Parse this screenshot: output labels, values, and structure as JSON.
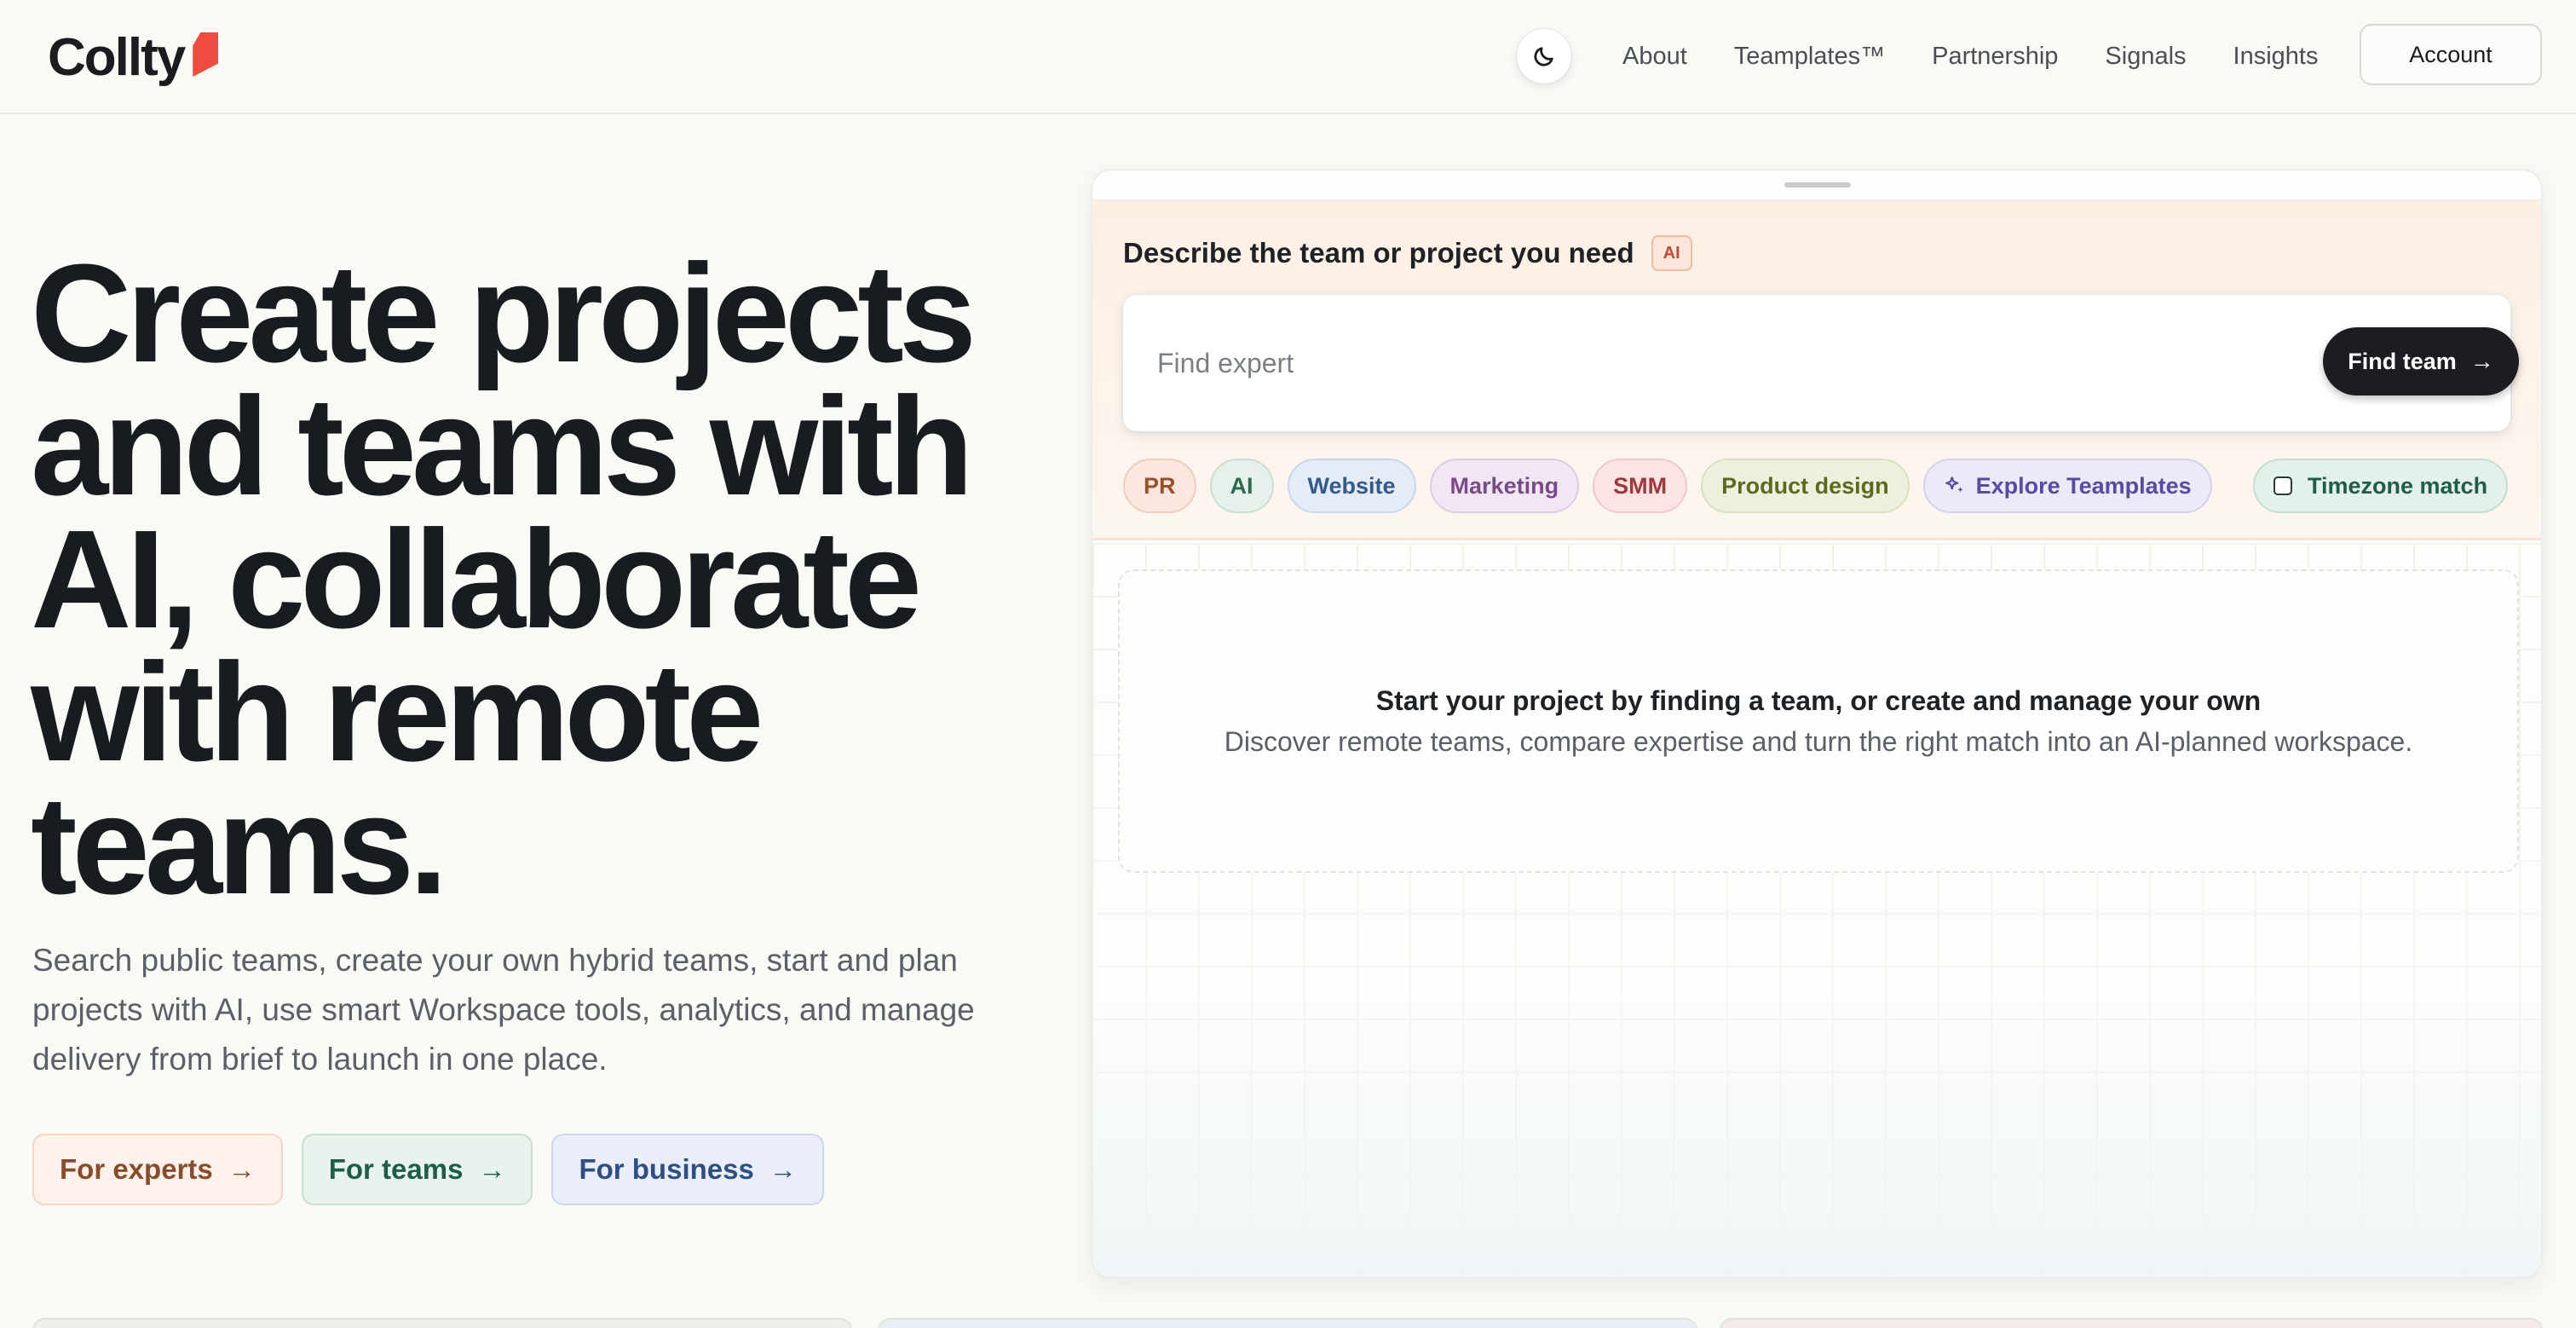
{
  "header": {
    "logo_text": "Collty",
    "nav": [
      "About",
      "Teamplates™",
      "Partnership",
      "Signals",
      "Insights"
    ],
    "account_label": "Account",
    "theme_toggle_icon": "moon-icon"
  },
  "hero": {
    "title": "Create projects and teams with AI, collaborate with remote teams.",
    "subtitle": "Search public teams, create your own hybrid teams, start and plan projects with AI, use smart Workspace tools, analytics, and manage delivery from brief to launch in one place.",
    "ctas": [
      {
        "label": "For experts",
        "arrow": "→"
      },
      {
        "label": "For teams",
        "arrow": "→"
      },
      {
        "label": "For business",
        "arrow": "→"
      }
    ]
  },
  "panel": {
    "label": "Describe the team or project you need",
    "ai_badge": "AI",
    "search_placeholder": "Find expert",
    "find_button": "Find team",
    "find_arrow": "→",
    "chips": [
      "PR",
      "AI",
      "Website",
      "Marketing",
      "SMM",
      "Product design"
    ],
    "explore_chip": "Explore Teamplates",
    "timezone_chip": "Timezone match",
    "empty_title": "Start your project by finding a team, or create and manage your own",
    "empty_subtitle": "Discover remote teams, compare expertise and turn the right match into an AI-planned workspace."
  },
  "colors": {
    "logo_accent": "#ef4b3f",
    "primary_button": "#1b1d20",
    "background": "#f9f9f6"
  }
}
